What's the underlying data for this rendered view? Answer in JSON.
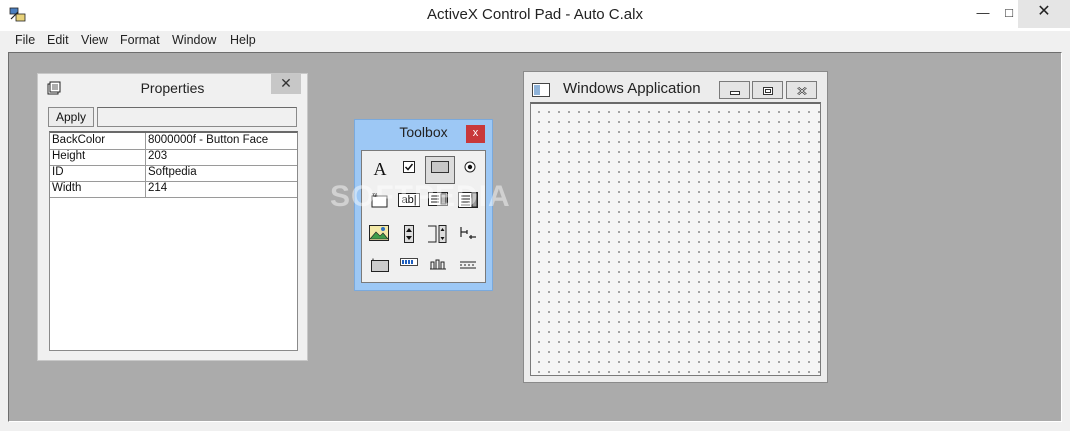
{
  "window": {
    "title": "ActiveX Control Pad - Auto C.alx",
    "minimize_glyph": "—",
    "maximize_glyph": "□",
    "close_glyph": "✕"
  },
  "menu": {
    "items": [
      "File",
      "Edit",
      "View",
      "Format",
      "Window",
      "Help"
    ]
  },
  "properties": {
    "title": "Properties",
    "close_glyph": "✕",
    "apply_label": "Apply",
    "apply_value": "",
    "rows": [
      {
        "name": "BackColor",
        "value": "8000000f - Button Face"
      },
      {
        "name": "Height",
        "value": "203"
      },
      {
        "name": "ID",
        "value": "Softpedia"
      },
      {
        "name": "Width",
        "value": "214"
      }
    ]
  },
  "toolbox": {
    "title": "Toolbox",
    "close_glyph": "x",
    "label_tool_glyph": "A",
    "textbox_tool_glyph": "ab|"
  },
  "form_window": {
    "title": "Windows Application"
  },
  "watermark": "SOFTPEDIA",
  "colors": {
    "mdi_background": "#ababab",
    "toolbox_titlebar": "#9dc8f5",
    "close_red": "#c8383a"
  }
}
